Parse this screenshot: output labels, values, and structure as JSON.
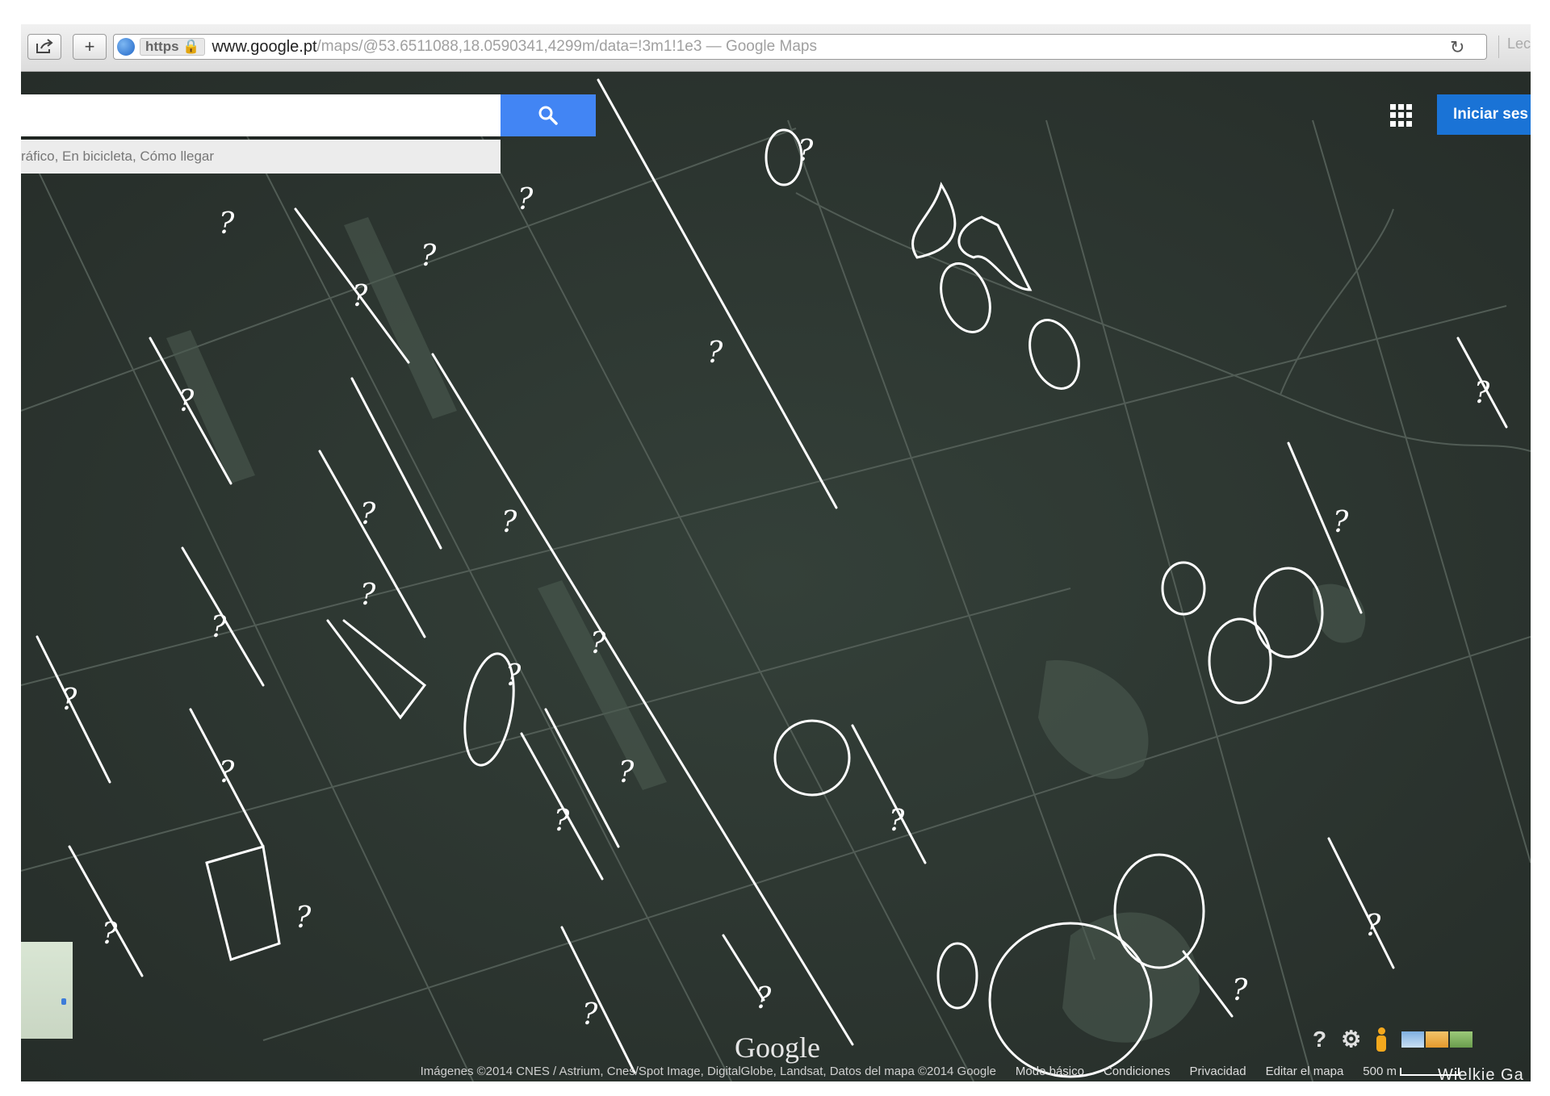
{
  "browser": {
    "https_label": "https",
    "url_domain": "www.google.pt",
    "url_rest": "/maps/@53.6511088,18.0590341,4299m/data=!3m1!1e3 — Google Maps",
    "reader_label": "Lecto",
    "share_icon": "share-icon",
    "new_tab_icon": "plus-icon",
    "reload_icon": "reload-icon"
  },
  "search": {
    "value": "",
    "hint": "ráfico, En bicicleta, Cómo llegar",
    "search_icon": "search-icon"
  },
  "header": {
    "apps_icon": "apps-grid-icon",
    "signin_label": "Iniciar ses"
  },
  "map": {
    "logo": "Google",
    "place_label": "Wielkie Ga",
    "annotation_mark": "?",
    "colors": {
      "terrain": "#2f3732",
      "annotation": "#ffffff",
      "accent": "#4285f4"
    }
  },
  "controls": {
    "help_icon": "help-icon",
    "settings_icon": "gear-icon",
    "pegman_icon": "pegman-icon",
    "layers_icon": "layers-icon"
  },
  "footer": {
    "attribution": "Imágenes ©2014 CNES / Astrium, Cnes/Spot Image, DigitalGlobe, Landsat, Datos del mapa ©2014 Google",
    "links": [
      "Modo básico",
      "Condiciones",
      "Privacidad",
      "Editar el mapa"
    ],
    "scale": "500 m"
  }
}
